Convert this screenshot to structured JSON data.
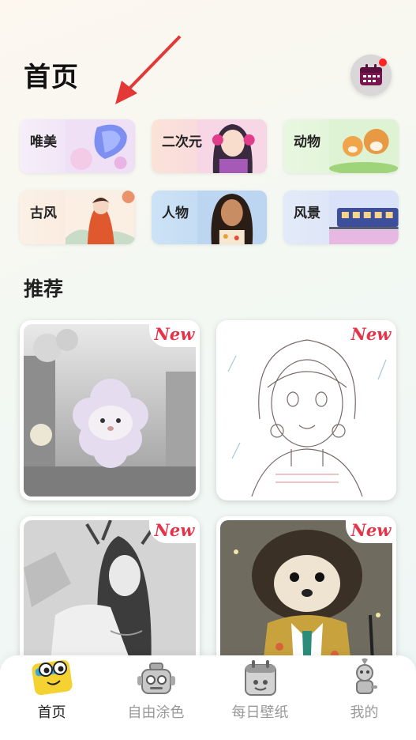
{
  "header": {
    "title": "首页"
  },
  "categories": [
    {
      "label": "唯美",
      "bg": "#efe3f7"
    },
    {
      "label": "二次元",
      "bg": "#fbe6d8"
    },
    {
      "label": "动物",
      "bg": "#e6f5df"
    },
    {
      "label": "古风",
      "bg": "#fbece0"
    },
    {
      "label": "人物",
      "bg": "#cfe3f6"
    },
    {
      "label": "风景",
      "bg": "#dde7f7"
    }
  ],
  "recommend": {
    "title": "推荐",
    "badge": "New"
  },
  "tabbar": {
    "items": [
      {
        "label": "首页",
        "active": true
      },
      {
        "label": "自由涂色",
        "active": false
      },
      {
        "label": "每日壁纸",
        "active": false
      },
      {
        "label": "我的",
        "active": false
      }
    ]
  },
  "colors": {
    "accent": "#e4344a",
    "notify": "#ff2222"
  }
}
